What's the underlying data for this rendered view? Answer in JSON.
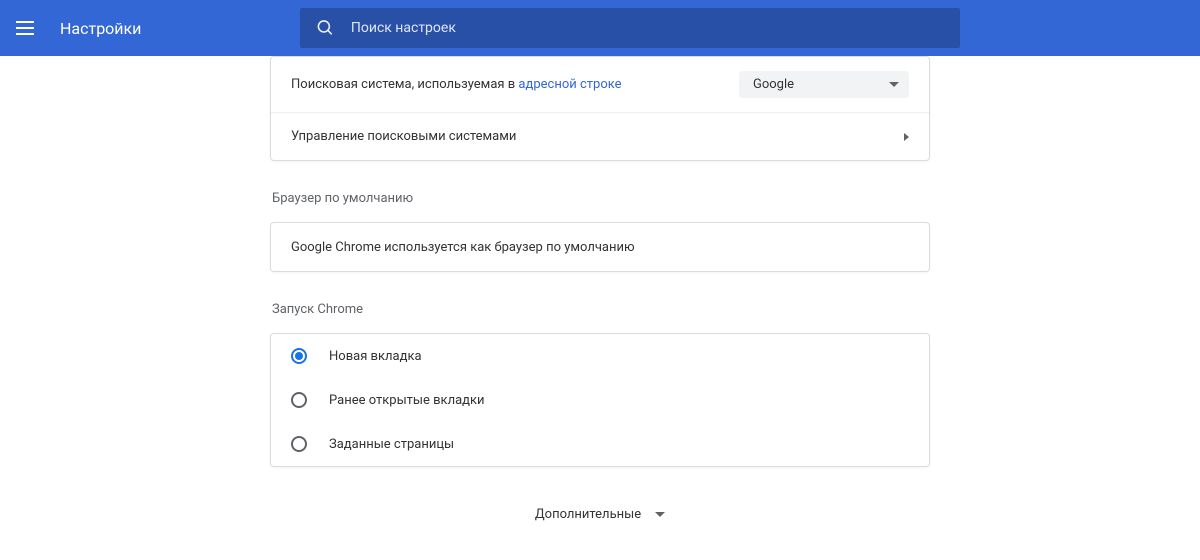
{
  "header": {
    "title": "Настройки",
    "search_placeholder": "Поиск настроек"
  },
  "search_engine": {
    "label_prefix": "Поисковая система, используемая в ",
    "label_link": "адресной строке",
    "selected": "Google",
    "manage": "Управление поисковыми системами"
  },
  "default_browser": {
    "title": "Браузер по умолчанию",
    "status": "Google Chrome используется как браузер по умолчанию"
  },
  "startup": {
    "title": "Запуск Chrome",
    "options": [
      {
        "label": "Новая вкладка",
        "checked": true
      },
      {
        "label": "Ранее открытые вкладки",
        "checked": false
      },
      {
        "label": "Заданные страницы",
        "checked": false
      }
    ]
  },
  "advanced": "Дополнительные"
}
